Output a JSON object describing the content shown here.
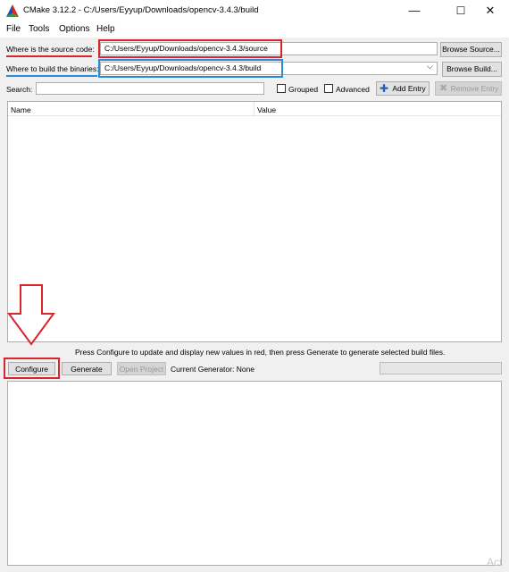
{
  "window": {
    "title": "CMake 3.12.2 - C:/Users/Eyyup/Downloads/opencv-3.4.3/build",
    "minimize": "—",
    "maximize": "☐",
    "close": "✕"
  },
  "menu": [
    "File",
    "Tools",
    "Options",
    "Help"
  ],
  "source": {
    "label": "Where is the source code:",
    "value": "C:/Users/Eyyup/Downloads/opencv-3.4.3/source",
    "button": "Browse Source..."
  },
  "build": {
    "label": "Where to build the binaries:",
    "value": "C:/Users/Eyyup/Downloads/opencv-3.4.3/build",
    "button": "Browse Build..."
  },
  "search": {
    "label": "Search:",
    "value": "",
    "grouped_label": "Grouped",
    "advanced_label": "Advanced",
    "add_entry": "Add Entry",
    "remove_entry": "Remove Entry"
  },
  "table": {
    "columns": [
      "Name",
      "Value"
    ]
  },
  "info_text": "Press Configure to update and display new values in red, then press Generate to generate selected build files.",
  "actions": {
    "configure": "Configure",
    "generate": "Generate",
    "open_project": "Open Project",
    "current_generator": "Current Generator: None"
  },
  "watermark": "Act",
  "colors": {
    "annotation_red": "#d9252c",
    "annotation_blue": "#2a8ad4"
  }
}
